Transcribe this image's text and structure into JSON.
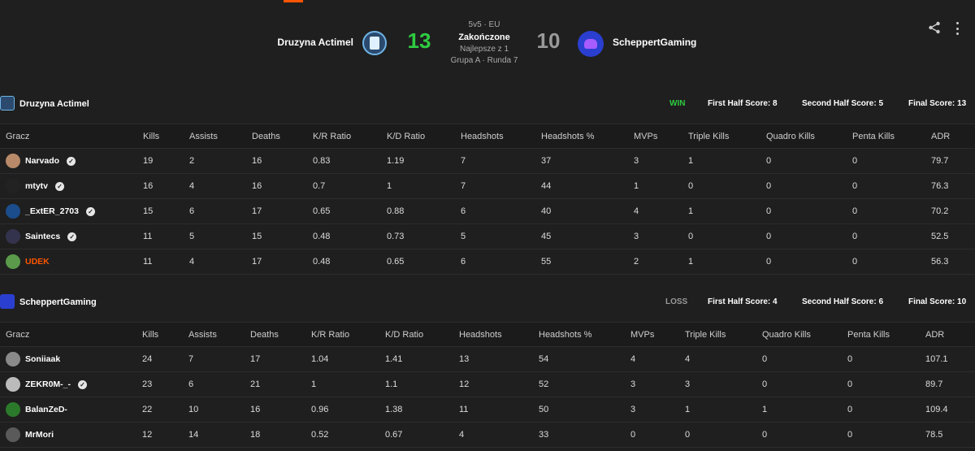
{
  "match": {
    "format": "5v5 · EU",
    "status": "Zakończone",
    "best_of": "Najlepsze z 1",
    "group_round": "Grupa A · Runda 7",
    "team1": {
      "name": "Druzyna Actimel",
      "score": "13",
      "color": "#2ecc40"
    },
    "team2": {
      "name": "ScheppertGaming",
      "score": "10",
      "color": "#9a9a9a"
    }
  },
  "headers": [
    "Gracz",
    "Kills",
    "Assists",
    "Deaths",
    "K/R Ratio",
    "K/D Ratio",
    "Headshots",
    "Headshots %",
    "MVPs",
    "Triple Kills",
    "Quadro Kills",
    "Penta Kills",
    "ADR"
  ],
  "team1": {
    "name": "Druzyna Actimel",
    "result": "WIN",
    "first_half": "First Half Score: 8",
    "second_half": "Second Half Score: 5",
    "final": "Final Score: 13",
    "players": [
      {
        "name": "Narvado",
        "verified": true,
        "stats": [
          "19",
          "2",
          "16",
          "0.83",
          "1.19",
          "7",
          "37",
          "3",
          "1",
          "0",
          "0",
          "79.7"
        ]
      },
      {
        "name": "mtytv",
        "verified": true,
        "stats": [
          "16",
          "4",
          "16",
          "0.7",
          "1",
          "7",
          "44",
          "1",
          "0",
          "0",
          "0",
          "76.3"
        ]
      },
      {
        "name": "_ExtER_2703",
        "verified": true,
        "stats": [
          "15",
          "6",
          "17",
          "0.65",
          "0.88",
          "6",
          "40",
          "4",
          "1",
          "0",
          "0",
          "70.2"
        ]
      },
      {
        "name": "Saintecs",
        "verified": true,
        "stats": [
          "11",
          "5",
          "15",
          "0.48",
          "0.73",
          "5",
          "45",
          "3",
          "0",
          "0",
          "0",
          "52.5"
        ]
      },
      {
        "name": "UDEK",
        "verified": false,
        "stats": [
          "11",
          "4",
          "17",
          "0.48",
          "0.65",
          "6",
          "55",
          "2",
          "1",
          "0",
          "0",
          "56.3"
        ]
      }
    ]
  },
  "team2": {
    "name": "ScheppertGaming",
    "result": "LOSS",
    "first_half": "First Half Score: 4",
    "second_half": "Second Half Score: 6",
    "final": "Final Score: 10",
    "players": [
      {
        "name": "Soniiaak",
        "verified": false,
        "stats": [
          "24",
          "7",
          "17",
          "1.04",
          "1.41",
          "13",
          "54",
          "4",
          "4",
          "0",
          "0",
          "107.1"
        ]
      },
      {
        "name": "ZEKR0M-_-",
        "verified": true,
        "stats": [
          "23",
          "6",
          "21",
          "1",
          "1.1",
          "12",
          "52",
          "3",
          "3",
          "0",
          "0",
          "89.7"
        ]
      },
      {
        "name": "BalanZeD-",
        "verified": false,
        "stats": [
          "22",
          "10",
          "16",
          "0.96",
          "1.38",
          "11",
          "50",
          "3",
          "1",
          "1",
          "0",
          "109.4"
        ]
      },
      {
        "name": "MrMori",
        "verified": false,
        "stats": [
          "12",
          "14",
          "18",
          "0.52",
          "0.67",
          "4",
          "33",
          "0",
          "0",
          "0",
          "0",
          "78.5"
        ]
      }
    ]
  },
  "colors": {
    "accent": "#ff5500",
    "win": "#2ecc40",
    "loss": "#9a9a9a",
    "background": "#1f1f1f"
  },
  "icons": {
    "share": "share-icon",
    "more": "more-vertical-icon",
    "verified": "verified-check-icon"
  }
}
